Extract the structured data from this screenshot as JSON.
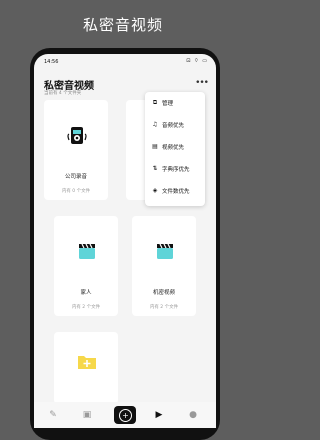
{
  "banner": {
    "title": "私密音视频"
  },
  "status": {
    "time": "14:56",
    "icons": "⊡ ⌔ ▭"
  },
  "header": {
    "title": "私密音视频",
    "subtitle": "当前有 4 个文件夹",
    "more_label": "•••"
  },
  "folders": [
    {
      "name": "公司录音",
      "count": "内有 0 个文件",
      "icon": "recorder-icon"
    },
    {
      "name": "",
      "count": "",
      "icon": "hidden-card"
    },
    {
      "name": "家人",
      "count": "内有 2 个文件",
      "icon": "clapperboard-icon"
    },
    {
      "name": "机密视频",
      "count": "内有 2 个文件",
      "icon": "clapperboard-icon"
    },
    {
      "name": "",
      "count": "",
      "icon": "folder-add-icon"
    }
  ],
  "menu": {
    "items": [
      {
        "label": "管理",
        "icon": "manage-icon"
      },
      {
        "label": "音频优先",
        "icon": "music-icon"
      },
      {
        "label": "视频优先",
        "icon": "video-icon"
      },
      {
        "label": "字典序优先",
        "icon": "dictionary-icon"
      },
      {
        "label": "文件数优先",
        "icon": "layers-icon"
      }
    ]
  },
  "colors": {
    "accent": "#5fd4d8",
    "folder": "#f6d84a",
    "dark": "#111111"
  },
  "bottom_tabs": [
    "notes-icon",
    "image-icon",
    "add-circle-icon",
    "play-icon",
    "user-icon"
  ]
}
